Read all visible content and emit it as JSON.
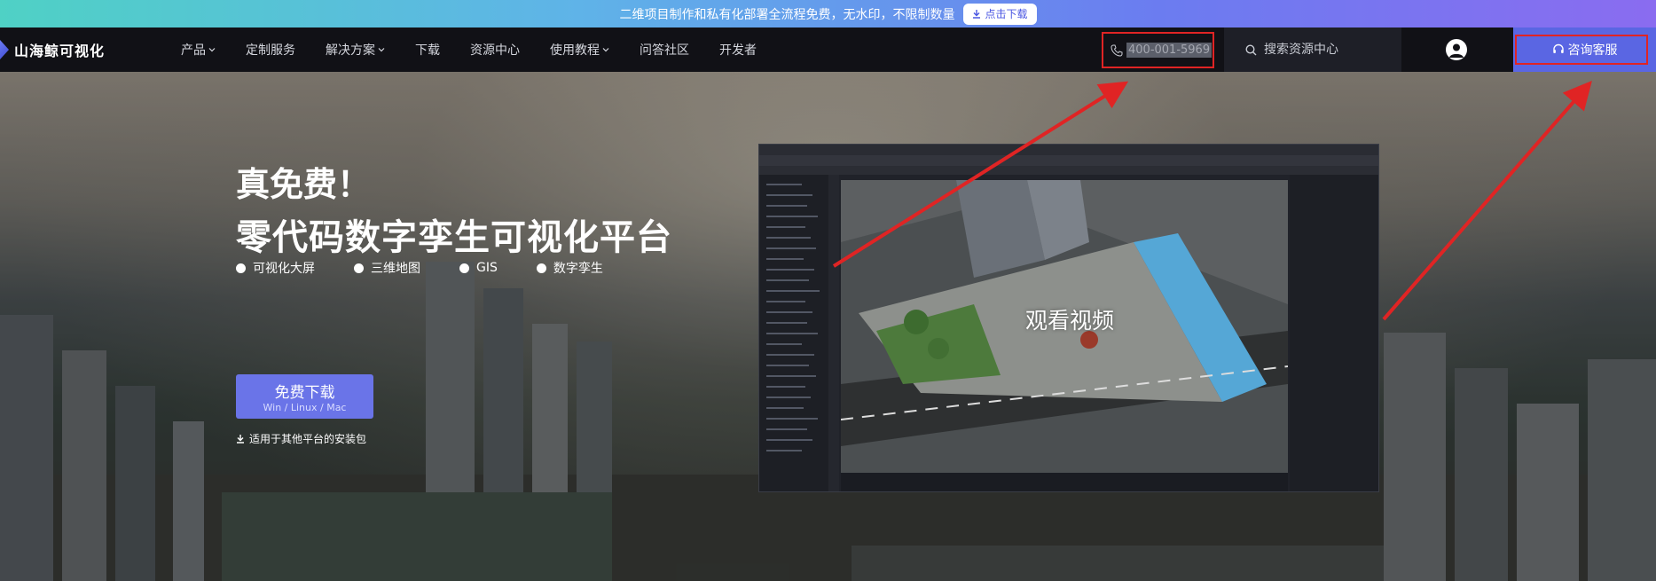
{
  "promo": {
    "text": "二维项目制作和私有化部署全流程免费，无水印，不限制数量",
    "button": "点击下载"
  },
  "navbar": {
    "logo": "山海鲸可视化",
    "items": [
      {
        "label": "产品",
        "dropdown": true
      },
      {
        "label": "定制服务",
        "dropdown": false
      },
      {
        "label": "解决方案",
        "dropdown": true
      },
      {
        "label": "下载",
        "dropdown": false
      },
      {
        "label": "资源中心",
        "dropdown": false
      },
      {
        "label": "使用教程",
        "dropdown": true
      },
      {
        "label": "问答社区",
        "dropdown": false
      },
      {
        "label": "开发者",
        "dropdown": false
      }
    ],
    "phone": "400-001-5969",
    "search_placeholder": "搜索资源中心",
    "consult": "咨询客服"
  },
  "hero": {
    "title1": "真免费！",
    "title2": "零代码数字孪生可视化平台",
    "features": [
      "可视化大屏",
      "三维地图",
      "GIS",
      "数字孪生"
    ],
    "download_main": "免费下载",
    "download_sub": "Win / Linux / Mac",
    "download_other": "适用于其他平台的安装包"
  },
  "video": {
    "play_label": "观看视频"
  },
  "colors": {
    "accent": "#5a66e3",
    "highlight_red": "#e02424",
    "navbar_bg": "#111116"
  }
}
